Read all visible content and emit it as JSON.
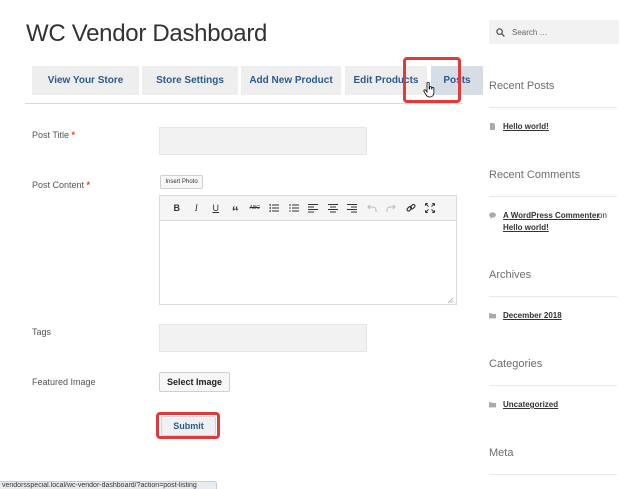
{
  "page": {
    "title": "WC Vendor Dashboard"
  },
  "tabs": [
    {
      "label": "View Your Store"
    },
    {
      "label": "Store Settings"
    },
    {
      "label": "Add New Product"
    },
    {
      "label": "Edit Products"
    },
    {
      "label": "Posts"
    }
  ],
  "form": {
    "post_title_label": "Post Title",
    "post_content_label": "Post Content",
    "required_marker": "*",
    "insert_photo_label": "Insert Photo",
    "tags_label": "Tags",
    "featured_image_label": "Featured Image",
    "select_image_label": "Select Image",
    "submit_label": "Submit",
    "toolbar": [
      {
        "icon": "bold-icon",
        "glyph": "B"
      },
      {
        "icon": "italic-icon",
        "glyph": "I"
      },
      {
        "icon": "underline-icon",
        "glyph": "U"
      },
      {
        "icon": "blockquote-icon",
        "glyph": "“"
      },
      {
        "icon": "strikethrough-icon",
        "glyph": "ABC"
      },
      {
        "icon": "bullet-list-icon",
        "glyph": ""
      },
      {
        "icon": "numbered-list-icon",
        "glyph": ""
      },
      {
        "icon": "align-left-icon",
        "glyph": ""
      },
      {
        "icon": "align-center-icon",
        "glyph": ""
      },
      {
        "icon": "align-right-icon",
        "glyph": ""
      },
      {
        "icon": "undo-icon",
        "glyph": ""
      },
      {
        "icon": "redo-icon",
        "glyph": ""
      },
      {
        "icon": "link-icon",
        "glyph": ""
      },
      {
        "icon": "fullscreen-icon",
        "glyph": ""
      }
    ]
  },
  "sidebar": {
    "search_placeholder": "Search …",
    "recent_posts_heading": "Recent Posts",
    "recent_post_1": "Hello world!",
    "recent_comments_heading": "Recent Comments",
    "comment_author": "A WordPress Commenter",
    "comment_on": "on",
    "comment_post": "Hello world!",
    "archives_heading": "Archives",
    "archive_1": "December 2018",
    "categories_heading": "Categories",
    "category_1": "Uncategorized",
    "meta_heading": "Meta"
  },
  "status_bar": {
    "url": "vendorsspecial.local/wc-vendor-dashboard/?action=post-listing"
  },
  "colors": {
    "accent": "#2c5a8c",
    "highlight": "#e03a3a",
    "required": "#e2401c"
  }
}
